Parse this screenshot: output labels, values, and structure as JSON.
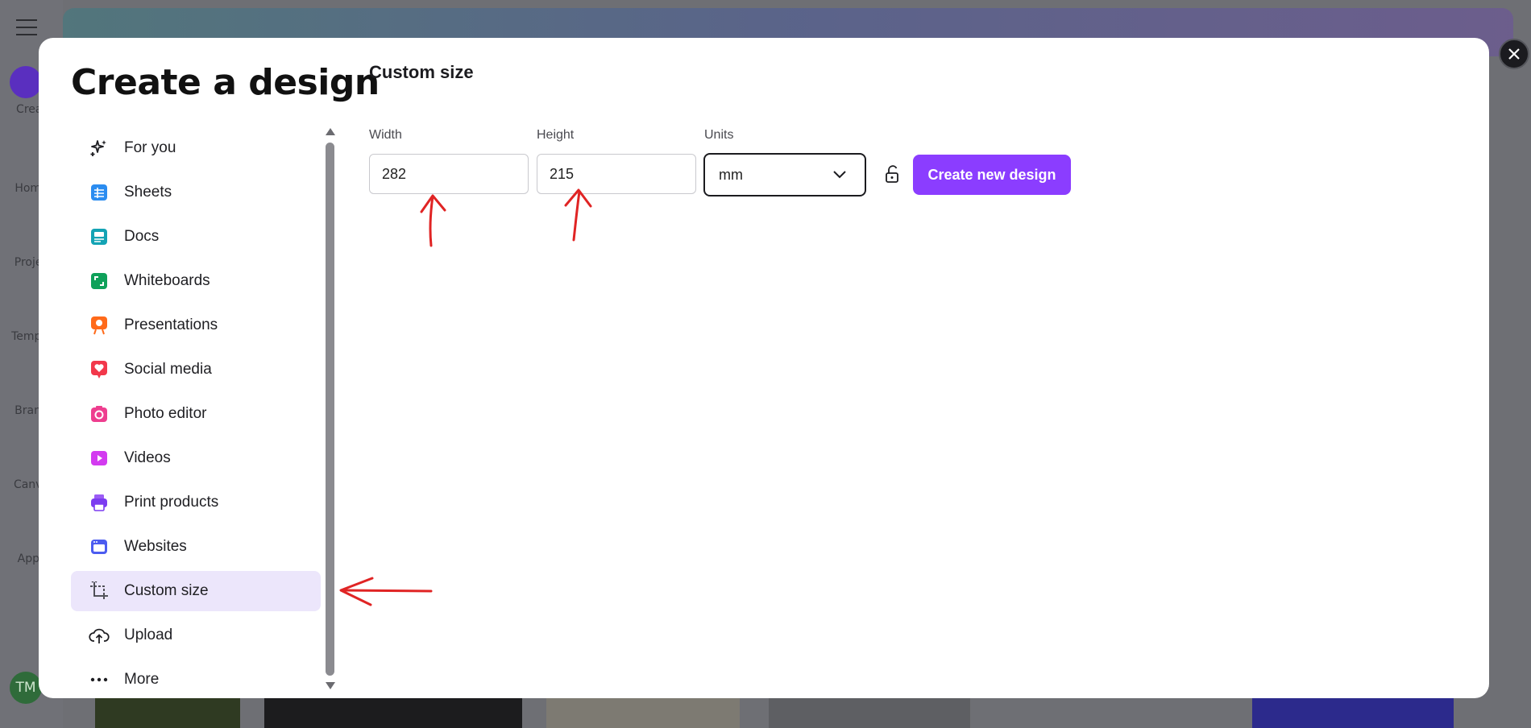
{
  "background": {
    "sidebar_labels": [
      "Creat",
      "Home",
      "Projec",
      "Templa",
      "Brand",
      "Canva",
      "Apps"
    ],
    "avatar_initials": "TM"
  },
  "modal": {
    "title": "Create a design",
    "close_icon": "close-icon"
  },
  "nav": {
    "items": [
      {
        "label": "For you",
        "icon": "sparkles-icon"
      },
      {
        "label": "Sheets",
        "icon": "sheets-icon"
      },
      {
        "label": "Docs",
        "icon": "docs-icon"
      },
      {
        "label": "Whiteboards",
        "icon": "whiteboard-icon"
      },
      {
        "label": "Presentations",
        "icon": "presentation-icon"
      },
      {
        "label": "Social media",
        "icon": "heart-icon"
      },
      {
        "label": "Photo editor",
        "icon": "camera-icon"
      },
      {
        "label": "Videos",
        "icon": "video-icon"
      },
      {
        "label": "Print products",
        "icon": "printer-icon"
      },
      {
        "label": "Websites",
        "icon": "website-icon"
      },
      {
        "label": "Custom size",
        "icon": "crop-icon",
        "active": true
      },
      {
        "label": "Upload",
        "icon": "cloud-upload-icon"
      },
      {
        "label": "More",
        "icon": "more-dots-icon"
      }
    ]
  },
  "custom_size": {
    "title": "Custom size",
    "width_label": "Width",
    "width_value": "282",
    "height_label": "Height",
    "height_value": "215",
    "units_label": "Units",
    "units_value": "mm",
    "create_button": "Create new design"
  },
  "colors": {
    "accent": "#8b3dff",
    "active_bg": "#ece6fb",
    "annotation": "#e02424"
  }
}
